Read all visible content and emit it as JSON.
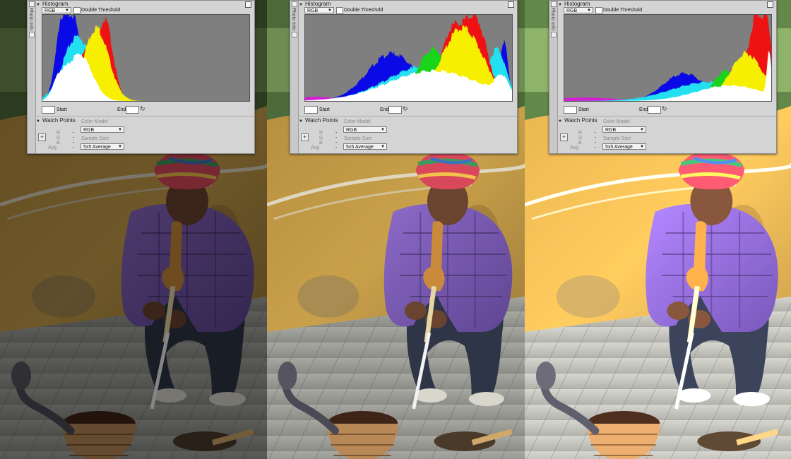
{
  "colors": {
    "hud_bg": "#d4d4d4",
    "histogram_bg": "#7f7f7f"
  },
  "panels": [
    {
      "id": "dark",
      "histogram_shape": "left-clustered",
      "photo_brightness": 0.55,
      "histogram": {
        "title": "Histogram",
        "model_value": "RGB",
        "double_threshold_label": "Double Threshold",
        "start_label": "Start",
        "end_label": "End",
        "side_tab": "Photo Info"
      },
      "watch_points": {
        "title": "Watch Points",
        "color_model_label": "Color Model",
        "color_model_value": "RGB",
        "channels": [
          "R",
          "G",
          "B",
          "Avg"
        ],
        "dash": "-",
        "sample_size_label": "Sample Size",
        "sample_size_value": "5x5 Average"
      }
    },
    {
      "id": "normal",
      "histogram_shape": "spread",
      "photo_brightness": 1.0,
      "histogram": {
        "title": "Histogram",
        "model_value": "RGB",
        "double_threshold_label": "Double Threshold",
        "start_label": "Start",
        "end_label": "End",
        "side_tab": "Photo Info"
      },
      "watch_points": {
        "title": "Watch Points",
        "color_model_label": "Color Model",
        "color_model_value": "RGB",
        "channels": [
          "R",
          "G",
          "B",
          "Avg"
        ],
        "dash": "-",
        "sample_size_label": "Sample Size",
        "sample_size_value": "5x5 Average"
      }
    },
    {
      "id": "bright",
      "histogram_shape": "right-clustered",
      "photo_brightness": 1.28,
      "histogram": {
        "title": "Histogram",
        "model_value": "RGB",
        "double_threshold_label": "Double Threshold",
        "start_label": "Start",
        "end_label": "End",
        "side_tab": "Photo Info"
      },
      "watch_points": {
        "title": "Watch Points",
        "color_model_label": "Color Model",
        "color_model_value": "RGB",
        "channels": [
          "R",
          "G",
          "B",
          "Avg"
        ],
        "dash": "-",
        "sample_size_label": "Sample Size",
        "sample_size_value": "5x5 Average"
      }
    }
  ]
}
